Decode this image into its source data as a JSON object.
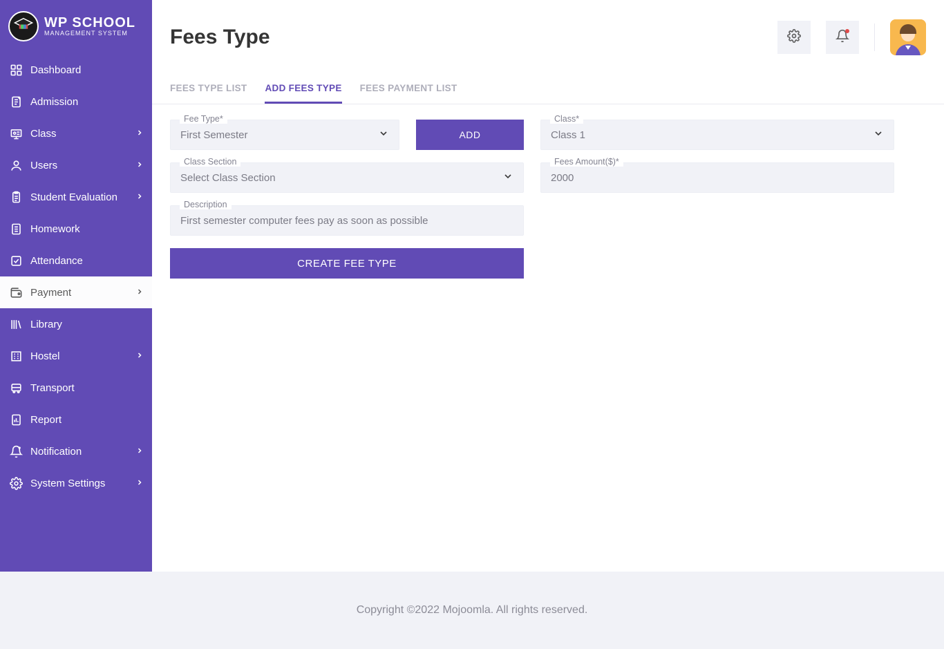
{
  "brand": {
    "line1": "WP SCHOOL",
    "line2": "MANAGEMENT SYSTEM"
  },
  "sidebar": {
    "items": [
      {
        "label": "Dashboard",
        "icon": "dashboard",
        "expandable": false,
        "active": false
      },
      {
        "label": "Admission",
        "icon": "admission",
        "expandable": false,
        "active": false
      },
      {
        "label": "Class",
        "icon": "class",
        "expandable": true,
        "active": false
      },
      {
        "label": "Users",
        "icon": "users",
        "expandable": true,
        "active": false
      },
      {
        "label": "Student Evaluation",
        "icon": "evaluation",
        "expandable": true,
        "active": false
      },
      {
        "label": "Homework",
        "icon": "homework",
        "expandable": false,
        "active": false
      },
      {
        "label": "Attendance",
        "icon": "attendance",
        "expandable": false,
        "active": false
      },
      {
        "label": "Payment",
        "icon": "payment",
        "expandable": true,
        "active": true
      },
      {
        "label": "Library",
        "icon": "library",
        "expandable": false,
        "active": false
      },
      {
        "label": "Hostel",
        "icon": "hostel",
        "expandable": true,
        "active": false
      },
      {
        "label": "Transport",
        "icon": "transport",
        "expandable": false,
        "active": false
      },
      {
        "label": "Report",
        "icon": "report",
        "expandable": false,
        "active": false
      },
      {
        "label": "Notification",
        "icon": "notification",
        "expandable": true,
        "active": false
      },
      {
        "label": "System Settings",
        "icon": "settings",
        "expandable": true,
        "active": false
      }
    ]
  },
  "header": {
    "title": "Fees Type"
  },
  "tabs": [
    {
      "label": "FEES TYPE LIST",
      "active": false
    },
    {
      "label": "ADD FEES TYPE",
      "active": true
    },
    {
      "label": "FEES PAYMENT LIST",
      "active": false
    }
  ],
  "form": {
    "fee_type_label": "Fee Type*",
    "fee_type_value": "First Semester",
    "add_button": "ADD",
    "class_label": "Class*",
    "class_value": "Class 1",
    "section_label": "Class Section",
    "section_value": "Select Class Section",
    "amount_label": "Fees Amount($)*",
    "amount_value": "2000",
    "desc_label": "Description",
    "desc_value": "First semester computer fees pay as soon as possible",
    "submit_button": "CREATE FEE TYPE"
  },
  "footer": {
    "text": "Copyright ©2022 Mojoomla. All rights reserved."
  }
}
